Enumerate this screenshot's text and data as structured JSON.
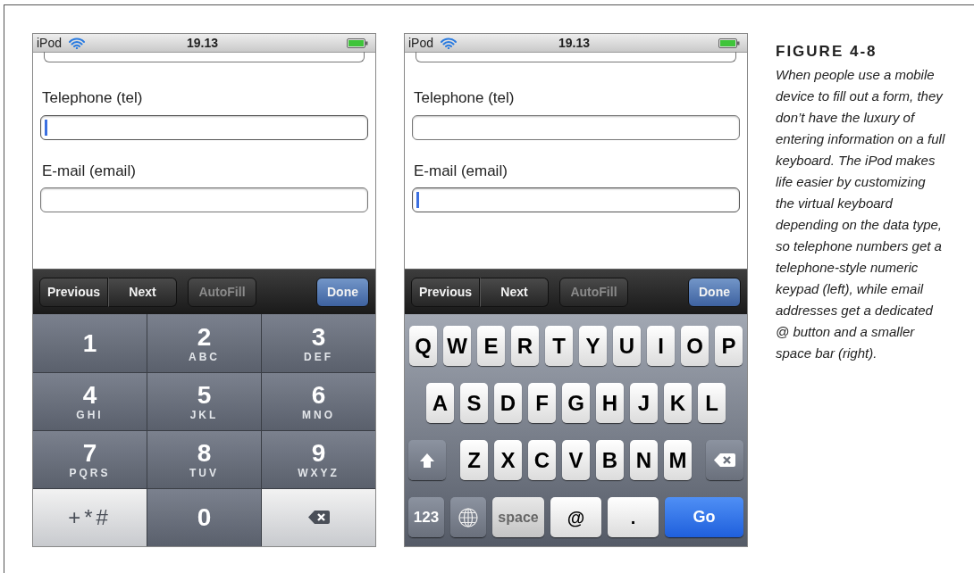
{
  "phones": [
    {
      "status": {
        "carrier": "iPod",
        "time": "19.13"
      },
      "fields": [
        {
          "label": "Telephone (tel)",
          "focused": true
        },
        {
          "label": "E-mail (email)",
          "focused": false
        }
      ],
      "toolbar": [
        {
          "label": "Previous",
          "kind": "segment",
          "disabled": false
        },
        {
          "label": "Next",
          "kind": "segment",
          "disabled": false
        },
        {
          "label": "AutoFill",
          "kind": "plain",
          "disabled": true
        },
        {
          "label": "Done",
          "kind": "done",
          "disabled": false
        }
      ],
      "keyboard": {
        "kind": "numeric",
        "keys": [
          {
            "kind": "digit",
            "label": "1"
          },
          {
            "kind": "digit",
            "label": "2",
            "letters": "ABC"
          },
          {
            "kind": "digit",
            "label": "3",
            "letters": "DEF"
          },
          {
            "kind": "digit",
            "label": "4",
            "letters": "GHI"
          },
          {
            "kind": "digit",
            "label": "5",
            "letters": "JKL"
          },
          {
            "kind": "digit",
            "label": "6",
            "letters": "MNO"
          },
          {
            "kind": "digit",
            "label": "7",
            "letters": "PQRS"
          },
          {
            "kind": "digit",
            "label": "8",
            "letters": "TUV"
          },
          {
            "kind": "digit",
            "label": "9",
            "letters": "WXYZ"
          },
          {
            "kind": "symbols",
            "label": "+*#"
          },
          {
            "kind": "digit",
            "label": "0"
          },
          {
            "kind": "delete"
          }
        ]
      }
    },
    {
      "status": {
        "carrier": "iPod",
        "time": "19.13"
      },
      "fields": [
        {
          "label": "Telephone (tel)",
          "focused": false
        },
        {
          "label": "E-mail (email)",
          "focused": true
        }
      ],
      "toolbar": [
        {
          "label": "Previous",
          "kind": "segment",
          "disabled": false
        },
        {
          "label": "Next",
          "kind": "segment",
          "disabled": false
        },
        {
          "label": "AutoFill",
          "kind": "plain",
          "disabled": true
        },
        {
          "label": "Done",
          "kind": "done",
          "disabled": false
        }
      ],
      "keyboard": {
        "kind": "alpha",
        "rows": [
          [
            {
              "kind": "letter",
              "label": "Q"
            },
            {
              "kind": "letter",
              "label": "W"
            },
            {
              "kind": "letter",
              "label": "E"
            },
            {
              "kind": "letter",
              "label": "R"
            },
            {
              "kind": "letter",
              "label": "T"
            },
            {
              "kind": "letter",
              "label": "Y"
            },
            {
              "kind": "letter",
              "label": "U"
            },
            {
              "kind": "letter",
              "label": "I"
            },
            {
              "kind": "letter",
              "label": "O"
            },
            {
              "kind": "letter",
              "label": "P"
            }
          ],
          [
            {
              "kind": "letter",
              "label": "A"
            },
            {
              "kind": "letter",
              "label": "S"
            },
            {
              "kind": "letter",
              "label": "D"
            },
            {
              "kind": "letter",
              "label": "F"
            },
            {
              "kind": "letter",
              "label": "G"
            },
            {
              "kind": "letter",
              "label": "H"
            },
            {
              "kind": "letter",
              "label": "J"
            },
            {
              "kind": "letter",
              "label": "K"
            },
            {
              "kind": "letter",
              "label": "L"
            }
          ],
          [
            {
              "kind": "shift"
            },
            {
              "kind": "letter",
              "label": "Z"
            },
            {
              "kind": "letter",
              "label": "X"
            },
            {
              "kind": "letter",
              "label": "C"
            },
            {
              "kind": "letter",
              "label": "V"
            },
            {
              "kind": "letter",
              "label": "B"
            },
            {
              "kind": "letter",
              "label": "N"
            },
            {
              "kind": "letter",
              "label": "M"
            },
            {
              "kind": "delete"
            }
          ]
        ],
        "bottom_keys": [
          {
            "kind": "mode",
            "label": "123"
          },
          {
            "kind": "globe"
          },
          {
            "kind": "space",
            "label": "space"
          },
          {
            "kind": "symbol",
            "label": "@"
          },
          {
            "kind": "symbol",
            "label": "."
          },
          {
            "kind": "go",
            "label": "Go"
          }
        ]
      }
    }
  ],
  "caption": {
    "title": "FIGURE 4-8",
    "text": "When people use a mobile device to fill out a form, they don’t have the luxury of entering information on a full keyboard. The iPod makes life easier by customizing the virtual keyboard depending on the data type, so telephone numbers get a telephone-style numeric keypad (left), while email addresses get a dedicated @ button and a smaller space bar (right)."
  }
}
